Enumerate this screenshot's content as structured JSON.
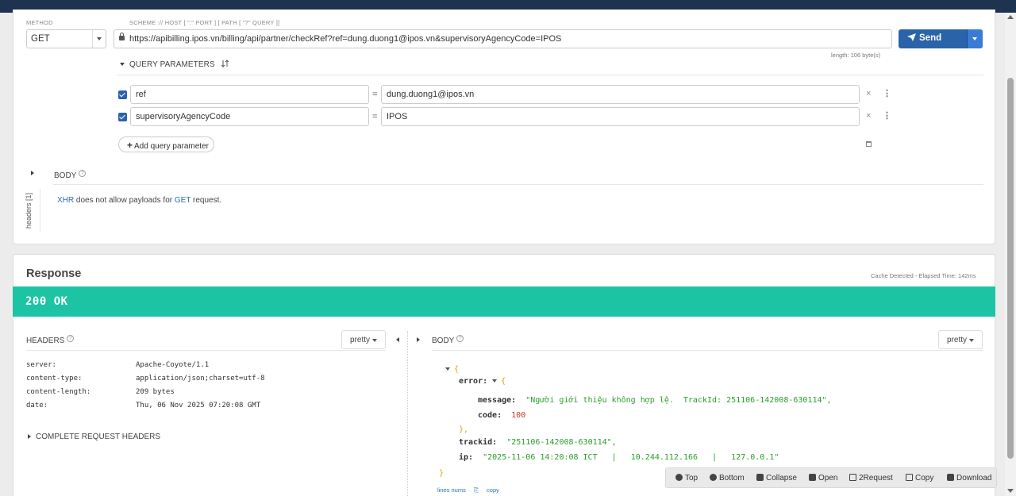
{
  "request": {
    "method_label": "METHOD",
    "scheme_label": "SCHEME :// HOST [ \":\" PORT ] [ PATH [ \"?\" QUERY ]]",
    "method": "GET",
    "url": "https://apibilling.ipos.vn/billing/api/partner/checkRef?ref=dung.duong1@ipos.vn&supervisoryAgencyCode=IPOS",
    "send_label": "Send",
    "length_note": "length: 106 byte(s)",
    "query_params_label": "QUERY PARAMETERS",
    "params": [
      {
        "key": "ref",
        "value": "dung.duong1@ipos.vn",
        "checked": true
      },
      {
        "key": "supervisoryAgencyCode",
        "value": "IPOS",
        "checked": true
      }
    ],
    "add_param_label": "Add query parameter",
    "body_label": "BODY",
    "headers_vertical": "headers [1]",
    "xhr_note": {
      "a": "XHR",
      "b": " does not allow payloads for ",
      "c": "GET",
      "d": " request."
    }
  },
  "response": {
    "title": "Response",
    "cache_note": "Cache Detected - Elapsed Time: 142ms",
    "status": "200 OK",
    "status_color": "#1cc4a4",
    "headers_label": "HEADERS",
    "body_label": "BODY",
    "pretty_label": "pretty",
    "headers": [
      {
        "k": "server:",
        "v": "Apache-Coyote/1.1"
      },
      {
        "k": "content-type:",
        "v": "application/json;charset=utf-8"
      },
      {
        "k": "content-length:",
        "v": "209 bytes"
      },
      {
        "k": "date:",
        "v": "Thu, 06 Nov 2025 07:20:08 GMT"
      }
    ],
    "complete_headers_label": "COMPLETE REQUEST HEADERS",
    "json": {
      "error_key": "error:",
      "message_key": "message:",
      "message_val": "\"Người giới thiệu không hợp lệ.  TrackId: 251106-142008-630114\",",
      "code_key": "code:",
      "code_val": "100",
      "trackid_key": "trackid:",
      "trackid_val": "\"251106-142008-630114\",",
      "ip_key": "ip:",
      "ip_val": "\"2025-11-06 14:20:08 ICT   |   10.244.112.166   |   127.0.0.1\""
    },
    "lines_nums_label": "lines nums",
    "copy_label": "copy"
  },
  "toolbar": {
    "top": "Top",
    "bottom": "Bottom",
    "collapse": "Collapse",
    "open": "Open",
    "to_request": "2Request",
    "copy": "Copy",
    "download": "Download"
  }
}
